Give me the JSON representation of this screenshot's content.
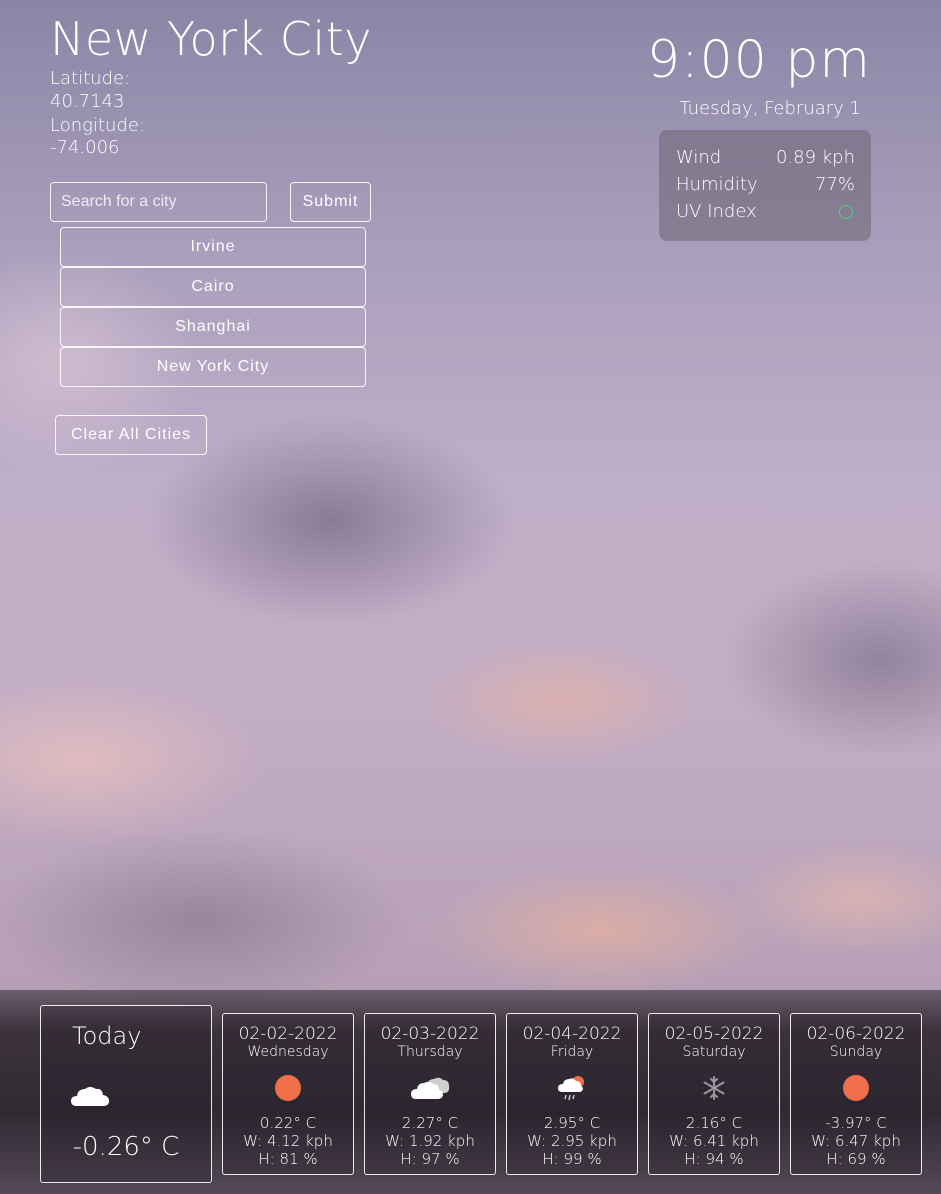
{
  "location": {
    "city": "New York City",
    "latitude_label": "Latitude:",
    "latitude": "40.7143",
    "longitude_label": "Longitude:",
    "longitude": "-74.006"
  },
  "search": {
    "placeholder": "Search for a city",
    "submit_label": "Submit"
  },
  "history": [
    {
      "label": "Irvine"
    },
    {
      "label": "Cairo"
    },
    {
      "label": "Shanghai"
    },
    {
      "label": "New York City"
    }
  ],
  "clear_label": "Clear All Cities",
  "clock": {
    "time": "9:00 pm",
    "date": "Tuesday, February 1"
  },
  "current": {
    "wind_label": "Wind",
    "wind": "0.89 kph",
    "humidity_label": "Humidity",
    "humidity": "77%",
    "uv_label": "UV Index",
    "uv_color": "#4cd080"
  },
  "today": {
    "label": "Today",
    "icon": "cloud-icon",
    "temp": "-0.26° C"
  },
  "forecast": [
    {
      "date": "02-02-2022",
      "day": "Wednesday",
      "icon": "sun-icon",
      "temp": "0.22° C",
      "wind": "W: 4.12 kph",
      "humidity": "H: 81 %"
    },
    {
      "date": "02-03-2022",
      "day": "Thursday",
      "icon": "clouds-icon",
      "temp": "2.27° C",
      "wind": "W: 1.92 kph",
      "humidity": "H: 97 %"
    },
    {
      "date": "02-04-2022",
      "day": "Friday",
      "icon": "rain-cloud-sun-icon",
      "temp": "2.95° C",
      "wind": "W: 2.95 kph",
      "humidity": "H: 99 %"
    },
    {
      "date": "02-05-2022",
      "day": "Saturday",
      "icon": "snowflake-icon",
      "temp": "2.16° C",
      "wind": "W: 6.41 kph",
      "humidity": "H: 94 %"
    },
    {
      "date": "02-06-2022",
      "day": "Sunday",
      "icon": "sun-icon",
      "temp": "-3.97° C",
      "wind": "W: 6.47 kph",
      "humidity": "H: 69 %"
    }
  ]
}
